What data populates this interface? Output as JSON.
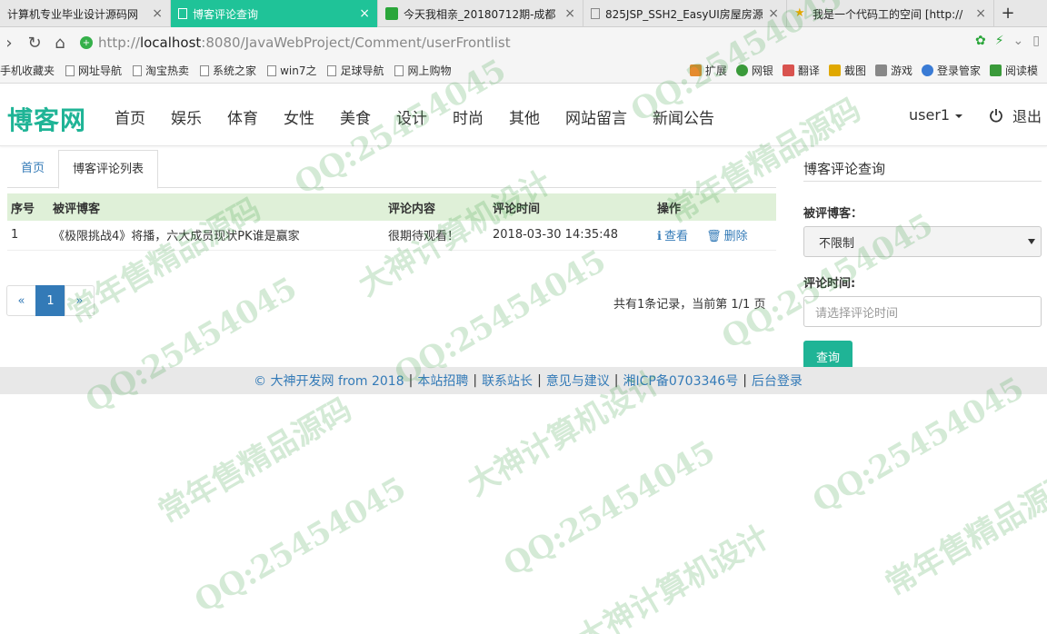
{
  "browser": {
    "tabs": [
      {
        "label": "计算机专业毕业设计源码网",
        "active": false
      },
      {
        "label": "博客评论查询",
        "active": true
      },
      {
        "label": "今天我相亲_20180712期-成都",
        "active": false
      },
      {
        "label": "825JSP_SSH2_EasyUI房屋房源",
        "active": false
      },
      {
        "label": "我是一个代码工的空间 [http://",
        "active": false
      }
    ],
    "url_prefix": "http://",
    "url_host": "localhost",
    "url_rest": ":8080/JavaWebProject/Comment/userFrontlist",
    "bookmarks": [
      "手机收藏夹",
      "网址导航",
      "淘宝热卖",
      "系统之家",
      "win7之",
      "足球导航",
      "网上购物"
    ],
    "bookmarks_right": [
      "扩展",
      "网银",
      "翻译",
      "截图",
      "游戏",
      "登录管家",
      "阅读模"
    ]
  },
  "site": {
    "brand": "博客网",
    "nav": [
      "首页",
      "娱乐",
      "体育",
      "女性",
      "美食",
      "设计",
      "时尚",
      "其他",
      "网站留言",
      "新闻公告"
    ],
    "user": "user1",
    "logout": "退出"
  },
  "breadcrumb": {
    "home": "首页",
    "current": "博客评论列表"
  },
  "table": {
    "headers": [
      "序号",
      "被评博客",
      "评论内容",
      "评论时间",
      "操作"
    ],
    "rows": [
      {
        "index": "1",
        "blog": "《极限挑战4》将播，六大成员现状PK谁是赢家",
        "content": "很期待观看！",
        "time": "2018-03-30 14:35:48",
        "view": "查看",
        "delete": "删除"
      }
    ]
  },
  "pagination": {
    "prev": "«",
    "current": "1",
    "next": "»",
    "info": "共有1条记录，当前第 1/1 页"
  },
  "search": {
    "title": "博客评论查询",
    "blog_label": "被评博客：",
    "blog_value": "不限制",
    "time_label": "评论时间:",
    "time_placeholder": "请选择评论时间",
    "submit": "查询"
  },
  "footer": {
    "copyright": "© 大神开发网 from 2018",
    "links": [
      "本站招聘",
      "联系站长",
      "意见与建议",
      "湘ICP备0703346号",
      "后台登录"
    ]
  },
  "watermark": {
    "qq": "QQ:25454045",
    "slogan1": "大神计算机设计",
    "slogan2": "常年售精品源码"
  },
  "colors": {
    "accent": "#1fb496",
    "active_tab": "#1fc398",
    "link": "#337ab7",
    "table_header": "#dff0d8"
  }
}
